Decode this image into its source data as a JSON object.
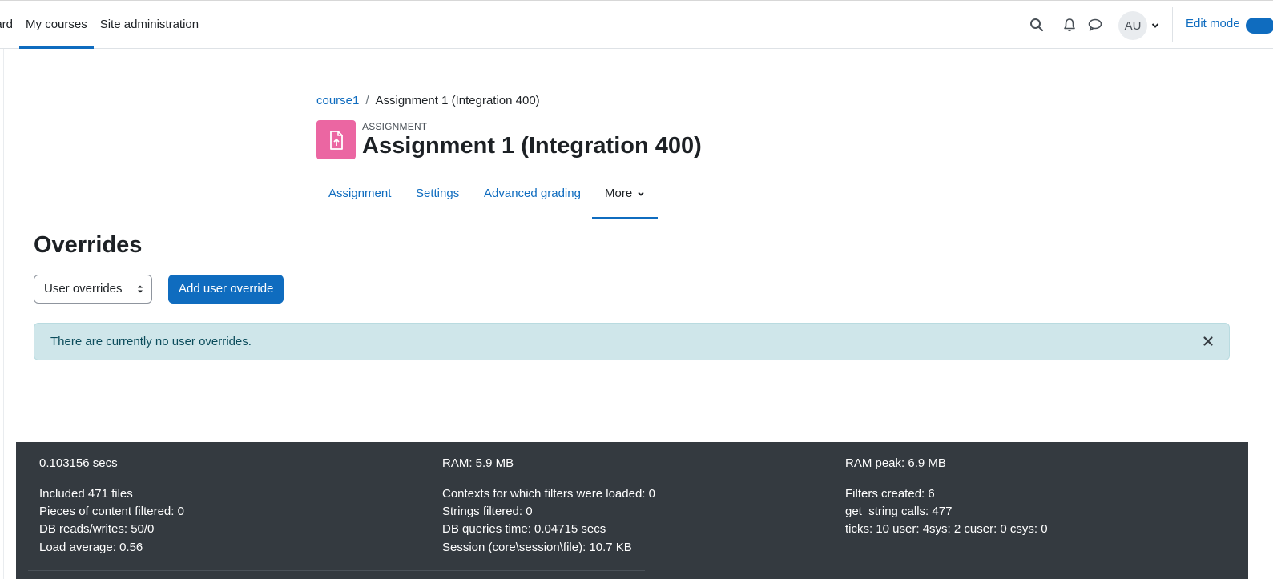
{
  "navbar": {
    "links": [
      {
        "label": "Dashboard",
        "visible_label": "oard"
      },
      {
        "label": "My courses"
      },
      {
        "label": "Site administration"
      }
    ],
    "active_link": "My courses",
    "avatar_initials": "AU",
    "edit_mode_label": "Edit mode",
    "edit_mode_on": true,
    "accent_color": "#0f6cbf"
  },
  "breadcrumb": {
    "course": "course1",
    "separator": "/",
    "current": "Assignment 1 (Integration 400)"
  },
  "activity": {
    "type_label": "ASSIGNMENT",
    "title": "Assignment 1 (Integration 400)",
    "icon": "assignment-file-upload-icon",
    "icon_color": "#eb66a2"
  },
  "secondary_nav": {
    "tabs": [
      "Assignment",
      "Settings",
      "Advanced grading",
      "More"
    ],
    "active_tab": "More"
  },
  "overrides": {
    "heading": "Overrides",
    "select_value": "User overrides",
    "add_button": "Add user override",
    "alert_text": "There are currently no user overrides."
  },
  "performance": {
    "col1": [
      "0.103156 secs",
      "Included 471 files",
      "Pieces of content filtered: 0",
      "DB reads/writes: 50/0",
      "Load average: 0.56"
    ],
    "col2": [
      "RAM: 5.9 MB",
      "Contexts for which filters were loaded: 0",
      "Strings filtered: 0",
      "DB queries time: 0.04715 secs",
      "Session (core\\session\\file): 10.7 KB"
    ],
    "col3": [
      "RAM peak: 6.9 MB",
      "Filters created: 6",
      "get_string calls: 477",
      "ticks: 10 user: 4sys: 2 cuser: 0 csys: 0"
    ]
  }
}
